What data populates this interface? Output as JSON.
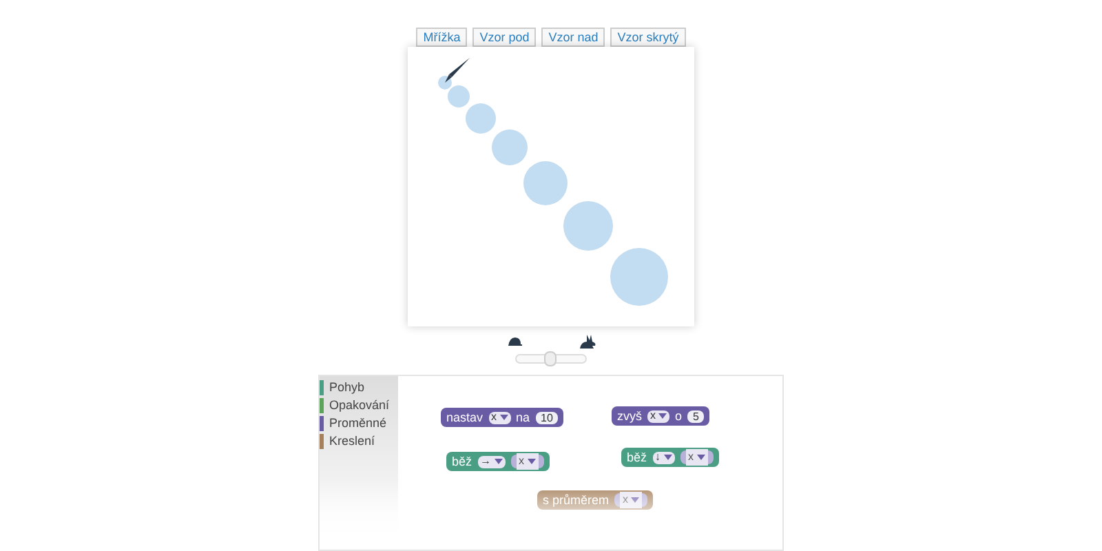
{
  "view_buttons": [
    {
      "label": "Mřížka"
    },
    {
      "label": "Vzor pod"
    },
    {
      "label": "Vzor nad"
    },
    {
      "label": "Vzor skrytý"
    }
  ],
  "speed": {
    "level": 0.5
  },
  "toolbox": [
    {
      "label": "Pohyb",
      "color": "#4a9e84"
    },
    {
      "label": "Opakování",
      "color": "#5ba55b"
    },
    {
      "label": "Proměnné",
      "color": "#6a5ba5"
    },
    {
      "label": "Kreslení",
      "color": "#a5805b"
    }
  ],
  "blocks": [
    {
      "kind": "variable",
      "parts": [
        {
          "kind": "text",
          "text": "nastav"
        },
        {
          "kind": "dropdown",
          "text": "x"
        },
        {
          "kind": "text",
          "text": "na"
        },
        {
          "kind": "number",
          "text": "10"
        }
      ]
    },
    {
      "kind": "variable",
      "parts": [
        {
          "kind": "text",
          "text": "zvyš"
        },
        {
          "kind": "dropdown",
          "text": "x"
        },
        {
          "kind": "text",
          "text": "o"
        },
        {
          "kind": "number",
          "text": "5"
        }
      ]
    },
    {
      "kind": "motion",
      "parts": [
        {
          "kind": "text",
          "text": "běž"
        },
        {
          "kind": "dropdown",
          "text": "→"
        },
        {
          "kind": "var",
          "text": "x"
        }
      ]
    },
    {
      "kind": "motion",
      "parts": [
        {
          "kind": "text",
          "text": "běž"
        },
        {
          "kind": "dropdown",
          "text": "↓"
        },
        {
          "kind": "var",
          "text": "x"
        }
      ]
    },
    {
      "kind": "drawing",
      "parts": [
        {
          "kind": "text",
          "text": "s průměrem"
        },
        {
          "kind": "var",
          "text": "x"
        }
      ]
    }
  ]
}
